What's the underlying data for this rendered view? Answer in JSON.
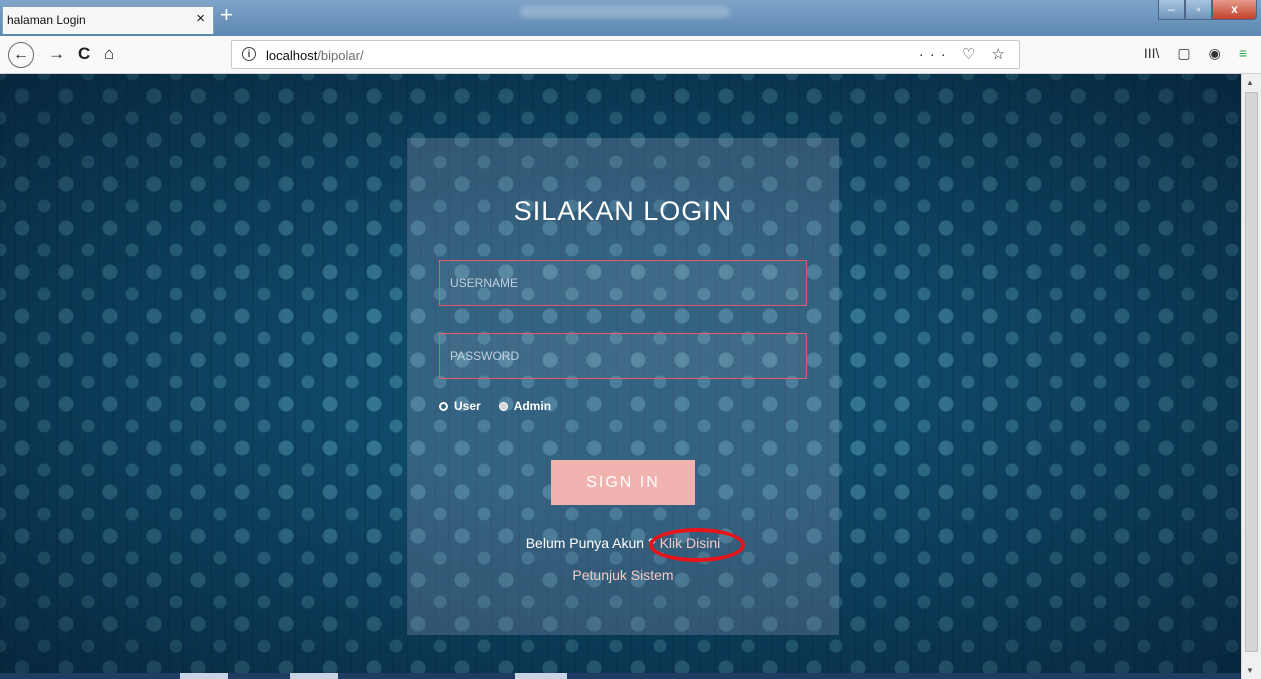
{
  "browser": {
    "tab_title": "halaman Login",
    "tab_close": "×",
    "new_tab": "+",
    "window": {
      "minimize": "–",
      "maximize": "▫",
      "close": "x"
    },
    "nav": {
      "back": "←",
      "forward": "→",
      "reload": "C",
      "home": "⌂"
    },
    "url": {
      "info": "i",
      "host": "localhost",
      "path": "/bipolar/"
    },
    "url_actions": "··· ♡ ☆",
    "toolbar_right": {
      "library": "III\\",
      "sidebar": "▢",
      "account": "◉",
      "menu": "≡"
    }
  },
  "login": {
    "title": "SILAKAN LOGIN",
    "username_placeholder": "USERNAME",
    "password_placeholder": "PASSWORD",
    "role_user": "User",
    "role_admin": "Admin",
    "sign_in": "SIGN IN",
    "no_account_text": "Belum Punya Akun ?",
    "register_link": "Klik Disini",
    "guide_link": "Petunjuk Sistem"
  },
  "colors": {
    "background": "#0f4a6a",
    "field_border": "#e05a6a",
    "button": "#f0b3b0",
    "annotation": "#e8141c"
  }
}
